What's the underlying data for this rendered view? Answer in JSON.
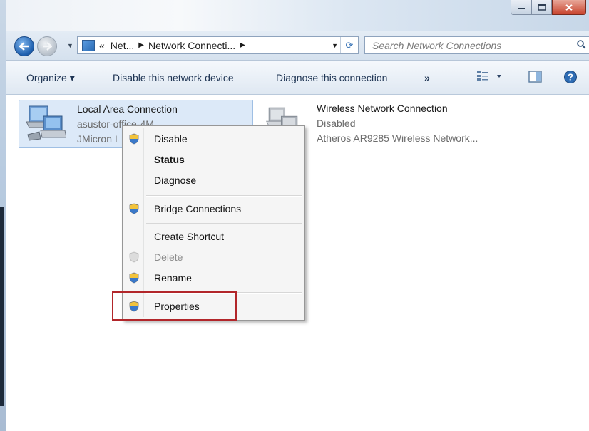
{
  "window": {
    "caption_buttons": [
      "minimize",
      "maximize",
      "close"
    ]
  },
  "address_bar": {
    "overflow": "«",
    "crumbs": [
      "Net...",
      "Network Connecti..."
    ]
  },
  "search": {
    "placeholder": "Search Network Connections"
  },
  "toolbar": {
    "organize": "Organize ▾",
    "disable": "Disable this network device",
    "diagnose": "Diagnose this connection",
    "more": "»"
  },
  "connections": [
    {
      "name": "Local Area Connection",
      "network": "asustor-office-4M",
      "adapter": "JMicron I"
    },
    {
      "name": "Wireless Network Connection",
      "network": "Disabled",
      "adapter": "Atheros AR9285 Wireless Network..."
    }
  ],
  "context_menu": {
    "items": [
      {
        "label": "Disable"
      },
      {
        "label": "Status"
      },
      {
        "label": "Diagnose"
      },
      {
        "label": "Bridge Connections"
      },
      {
        "label": "Create Shortcut"
      },
      {
        "label": "Delete"
      },
      {
        "label": "Rename"
      },
      {
        "label": "Properties"
      }
    ]
  },
  "colors": {
    "accent": "#1e5fae",
    "highlight_box": "#b2262a",
    "selection": "#dce9f8"
  },
  "icons": [
    "back-arrow-icon",
    "forward-arrow-icon",
    "network-connections-icon",
    "refresh-icon",
    "search-icon",
    "view-options-icon",
    "preview-pane-icon",
    "help-icon",
    "network-adapter-icon",
    "uac-shield-icon"
  ]
}
